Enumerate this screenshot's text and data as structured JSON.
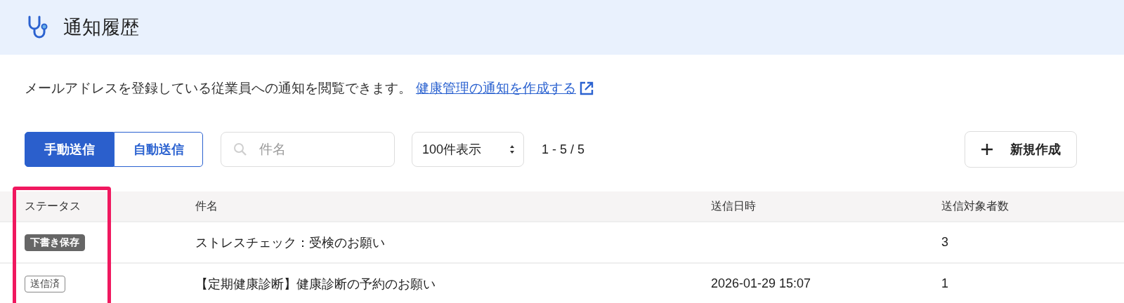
{
  "header": {
    "title": "通知履歴"
  },
  "description": {
    "text": "メールアドレスを登録している従業員への通知を閲覧できます。",
    "link": "健康管理の通知を作成する"
  },
  "tabs": [
    {
      "label": "手動送信",
      "selected": true
    },
    {
      "label": "自動送信",
      "selected": false
    }
  ],
  "search": {
    "placeholder": "件名"
  },
  "page_size": {
    "value": "100件表示"
  },
  "range": "1 - 5 / 5",
  "new_button": {
    "label": "新規作成"
  },
  "table": {
    "columns": [
      "ステータス",
      "件名",
      "送信日時",
      "送信対象者数"
    ],
    "rows": [
      {
        "status": {
          "label": "下書き保存",
          "kind": "draft"
        },
        "subject": "ストレスチェック：受検のお願い",
        "sent_at": "",
        "recipients": "3"
      },
      {
        "status": {
          "label": "送信済",
          "kind": "sent"
        },
        "subject": "【定期健康診断】健康診断の予約のお願い",
        "sent_at": "2026-01-29 15:07",
        "recipients": "1"
      }
    ]
  },
  "highlight": {
    "kind": "frame"
  }
}
